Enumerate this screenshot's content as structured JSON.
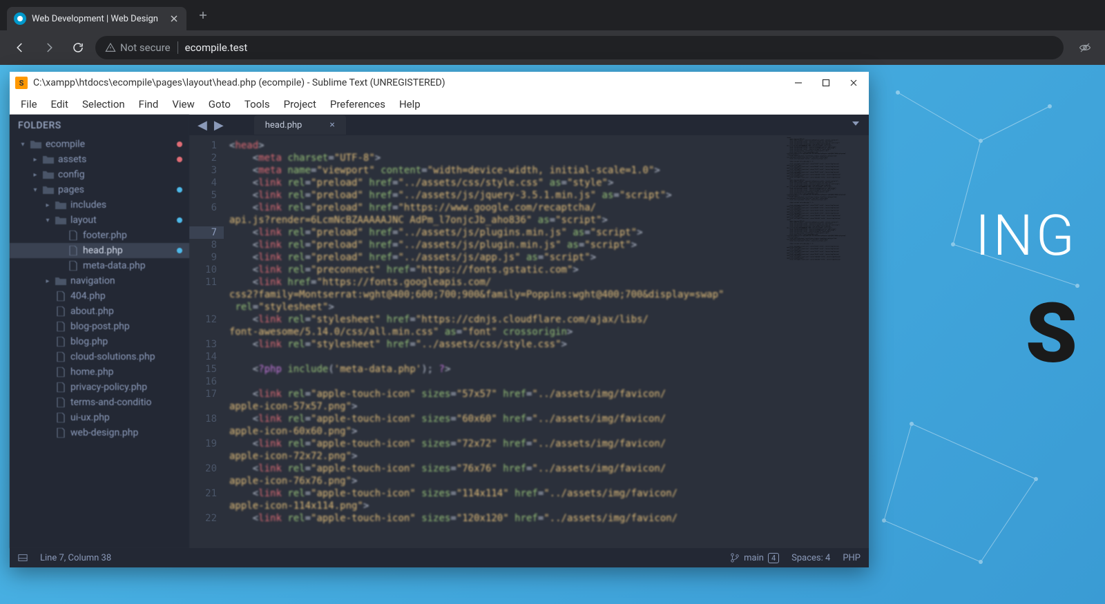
{
  "browser": {
    "tab_title": "Web Development | Web Design",
    "security_label": "Not secure",
    "url": "ecompile.test"
  },
  "page_hero": {
    "line1": "ING",
    "line2": "S"
  },
  "sublime": {
    "titlebar": "C:\\xampp\\htdocs\\ecompile\\pages\\layout\\head.php (ecompile) - Sublime Text (UNREGISTERED)",
    "menu": [
      "File",
      "Edit",
      "Selection",
      "Find",
      "View",
      "Goto",
      "Tools",
      "Project",
      "Preferences",
      "Help"
    ],
    "sidebar_header": "FOLDERS",
    "tree": [
      {
        "lvl": 1,
        "icon": "folder",
        "arrow": "▾",
        "label": "ecompile",
        "dot": "red"
      },
      {
        "lvl": 2,
        "icon": "folder",
        "arrow": "▸",
        "label": "assets",
        "dot": "red"
      },
      {
        "lvl": 2,
        "icon": "folder",
        "arrow": "▸",
        "label": "config"
      },
      {
        "lvl": 2,
        "icon": "folder",
        "arrow": "▾",
        "label": "pages",
        "dot": "blue"
      },
      {
        "lvl": 3,
        "icon": "folder",
        "arrow": "▸",
        "label": "includes"
      },
      {
        "lvl": 3,
        "icon": "folder",
        "arrow": "▾",
        "label": "layout",
        "dot": "blue"
      },
      {
        "lvl": 4,
        "icon": "file",
        "arrow": "",
        "label": "footer.php"
      },
      {
        "lvl": 4,
        "icon": "file",
        "arrow": "",
        "label": "head.php",
        "selected": true,
        "dot": "blue"
      },
      {
        "lvl": 4,
        "icon": "file",
        "arrow": "",
        "label": "meta-data.php"
      },
      {
        "lvl": 3,
        "icon": "folder",
        "arrow": "▸",
        "label": "navigation"
      },
      {
        "lvl": 3,
        "icon": "file",
        "arrow": "",
        "label": "404.php"
      },
      {
        "lvl": 3,
        "icon": "file",
        "arrow": "",
        "label": "about.php"
      },
      {
        "lvl": 3,
        "icon": "file",
        "arrow": "",
        "label": "blog-post.php"
      },
      {
        "lvl": 3,
        "icon": "file",
        "arrow": "",
        "label": "blog.php"
      },
      {
        "lvl": 3,
        "icon": "file",
        "arrow": "",
        "label": "cloud-solutions.php"
      },
      {
        "lvl": 3,
        "icon": "file",
        "arrow": "",
        "label": "home.php"
      },
      {
        "lvl": 3,
        "icon": "file",
        "arrow": "",
        "label": "privacy-policy.php"
      },
      {
        "lvl": 3,
        "icon": "file",
        "arrow": "",
        "label": "terms-and-conditio"
      },
      {
        "lvl": 3,
        "icon": "file",
        "arrow": "",
        "label": "ui-ux.php"
      },
      {
        "lvl": 3,
        "icon": "file",
        "arrow": "",
        "label": "web-design.php"
      }
    ],
    "open_tab": "head.php",
    "gutter": [
      {
        "n": "1"
      },
      {
        "n": "2"
      },
      {
        "n": "3"
      },
      {
        "n": "4"
      },
      {
        "n": "5"
      },
      {
        "n": "6",
        "span": 2
      },
      {
        "n": "7",
        "hl": true
      },
      {
        "n": "8"
      },
      {
        "n": "9"
      },
      {
        "n": "10"
      },
      {
        "n": "11",
        "span": 3
      },
      {
        "n": "12",
        "span": 2
      },
      {
        "n": "13"
      },
      {
        "n": "14"
      },
      {
        "n": "15"
      },
      {
        "n": "16"
      },
      {
        "n": "17",
        "span": 2
      },
      {
        "n": "18",
        "span": 2
      },
      {
        "n": "19",
        "span": 2
      },
      {
        "n": "20",
        "span": 2
      },
      {
        "n": "21",
        "span": 2
      },
      {
        "n": "22"
      }
    ],
    "status": {
      "cursor": "Line 7, Column 38",
      "branch": "main",
      "branch_count": "4",
      "spaces": "Spaces: 4",
      "lang": "PHP"
    }
  }
}
